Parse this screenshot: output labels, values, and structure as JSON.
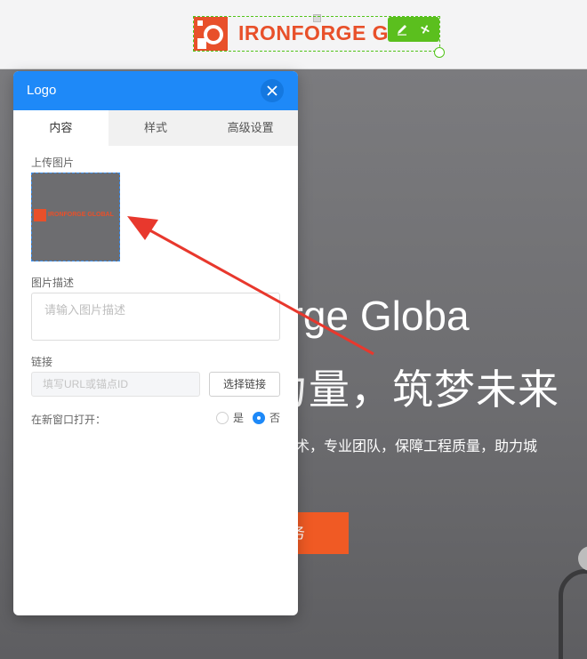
{
  "hero": {
    "title_line1": "orge Globa",
    "title_line2": "力量，筑梦未来",
    "description": "进技术，专业团队，保障工程质量，助力城",
    "button_label": "务"
  },
  "logo": {
    "text": "IRONFORGE GL",
    "thumbnail_text": "IRONFORGE GLOBAL",
    "edit_icon": "pencil-icon",
    "settings_icon": "fan-icon"
  },
  "panel": {
    "title": "Logo",
    "close_icon": "close-icon",
    "tabs": [
      {
        "label": "内容",
        "active": true
      },
      {
        "label": "样式",
        "active": false
      },
      {
        "label": "高级设置",
        "active": false
      }
    ],
    "upload_label": "上传图片",
    "description_label": "图片描述",
    "description_placeholder": "请输入图片描述",
    "link_label": "链接",
    "link_placeholder": "填写URL或锚点ID",
    "link_button": "选择链接",
    "new_window_label": "在新窗口打开：",
    "new_window_options": [
      {
        "label": "是",
        "selected": false
      },
      {
        "label": "否",
        "selected": true
      }
    ]
  },
  "colors": {
    "accent": "#1e89f8",
    "brand": "#e8502a",
    "selection": "#52c41a",
    "arrow": "#e8382d"
  }
}
